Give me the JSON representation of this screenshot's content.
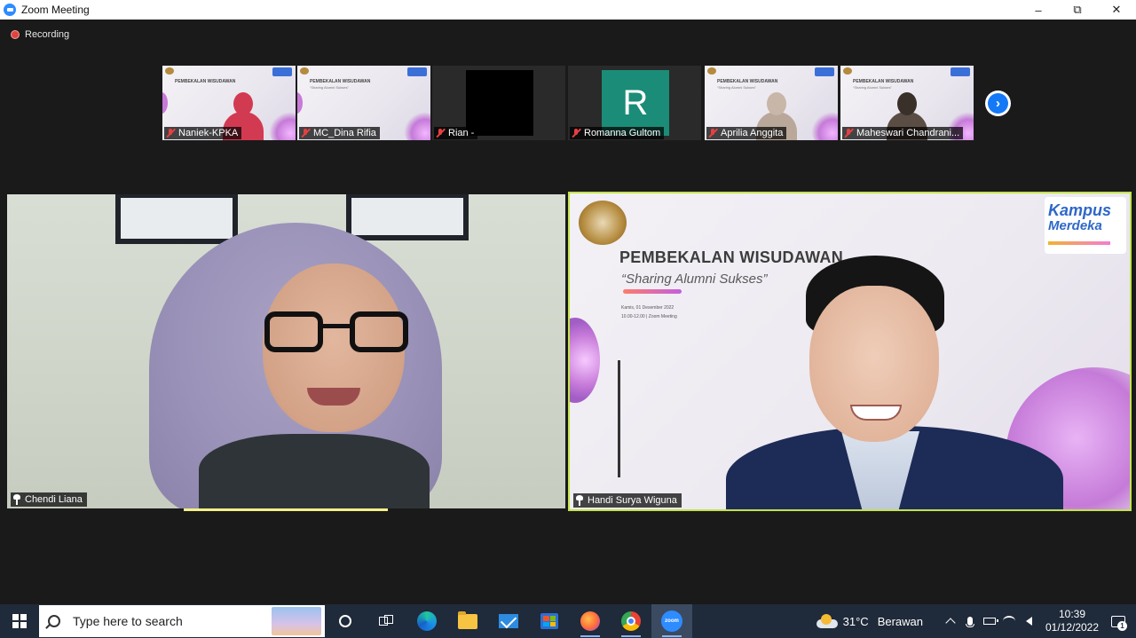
{
  "window": {
    "title": "Zoom Meeting",
    "controls": {
      "minimize": "–",
      "maximize": "⧉",
      "close": "✕"
    }
  },
  "recording": {
    "label": "Recording",
    "color": "#e0443e"
  },
  "gallery": {
    "participants": [
      {
        "name": "Naniek-KPKA",
        "muted": true,
        "view": "video"
      },
      {
        "name": "MC_Dina Rifia",
        "muted": true,
        "view": "video"
      },
      {
        "name": "Rian -",
        "muted": true,
        "view": "video-off"
      },
      {
        "name": "Romanna Gultom",
        "muted": true,
        "view": "avatar",
        "initial": "R",
        "avatar_color": "#1b8c77"
      },
      {
        "name": "Aprilia Anggita",
        "muted": true,
        "view": "video"
      },
      {
        "name": "Maheswari Chandrani...",
        "muted": true,
        "view": "video"
      }
    ],
    "next_icon": "›"
  },
  "speakers": {
    "left": {
      "name": "Chendi Liana"
    },
    "right": {
      "name": "Handi Surya Wiguna",
      "active_border_color": "#c3e34a",
      "slide": {
        "title": "PEMBEKALAN WISUDAWAN",
        "subtitle": "“Sharing Alumni Sukses”",
        "date_line": "Kamis, 01 Desember 2022",
        "time_line": "10.00-12.00 | Zoom Meeting",
        "logo_line1": "Kampus",
        "logo_line2": "Merdeka"
      }
    }
  },
  "thumb_slide": {
    "title": "PEMBEKALAN WISUDAWAN",
    "subtitle": "“Sharing Alumni Sukses”"
  },
  "taskbar": {
    "search_placeholder": "Type here to search",
    "weather": {
      "temp": "31°C",
      "desc": "Berawan"
    },
    "clock": {
      "time": "10:39",
      "date": "01/12/2022"
    },
    "notification_count": "1",
    "zoom_label": "zoom"
  }
}
